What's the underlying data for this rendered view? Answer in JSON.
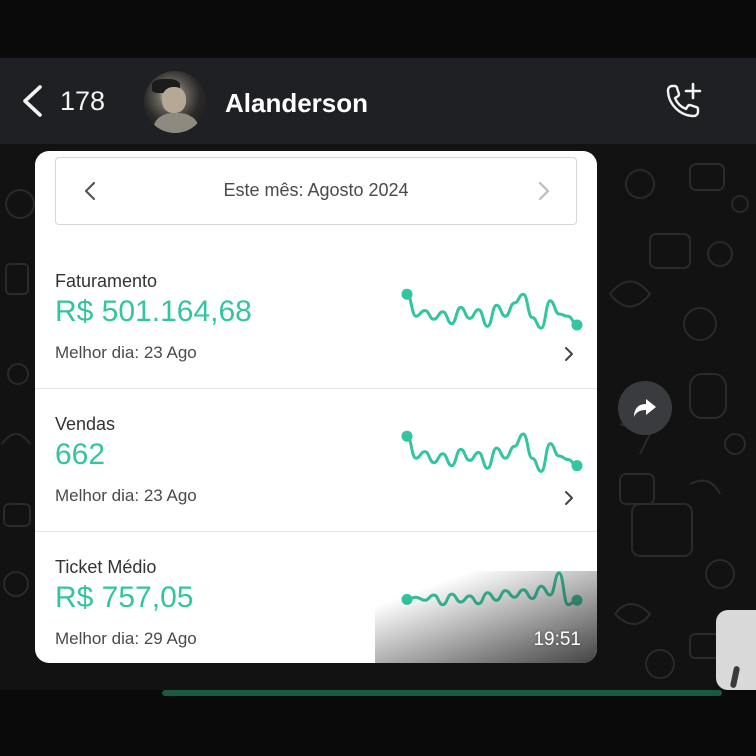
{
  "header": {
    "unread_count": "178",
    "contact_name": "Alanderson"
  },
  "dashboard": {
    "period_label": "Este mês: Agosto 2024",
    "metrics": [
      {
        "title": "Faturamento",
        "value": "R$ 501.164,68",
        "best_day": "Melhor dia: 23 Ago",
        "spark": [
          0.05,
          0.55,
          0.42,
          0.62,
          0.45,
          0.72,
          0.35,
          0.6,
          0.4,
          0.78,
          0.3,
          0.55,
          0.25,
          0.05,
          0.58,
          0.82,
          0.2,
          0.5,
          0.55,
          0.75
        ]
      },
      {
        "title": "Vendas",
        "value": "662",
        "best_day": "Melhor dia: 23 Ago",
        "spark": [
          0.05,
          0.55,
          0.4,
          0.65,
          0.45,
          0.72,
          0.35,
          0.6,
          0.42,
          0.78,
          0.32,
          0.55,
          0.28,
          0.0,
          0.55,
          0.85,
          0.22,
          0.5,
          0.58,
          0.72
        ]
      },
      {
        "title": "Ticket Médio",
        "value": "R$ 757,05",
        "best_day": "Melhor dia: 29 Ago",
        "spark": [
          0.6,
          0.55,
          0.62,
          0.5,
          0.72,
          0.48,
          0.66,
          0.52,
          0.7,
          0.45,
          0.62,
          0.4,
          0.55,
          0.38,
          0.58,
          0.3,
          0.5,
          0.0,
          0.72,
          0.62
        ]
      }
    ]
  },
  "message": {
    "time": "19:51"
  },
  "colors": {
    "accent": "#33c4a0",
    "header_bg": "#1f2023",
    "chat_bg": "#121212"
  }
}
